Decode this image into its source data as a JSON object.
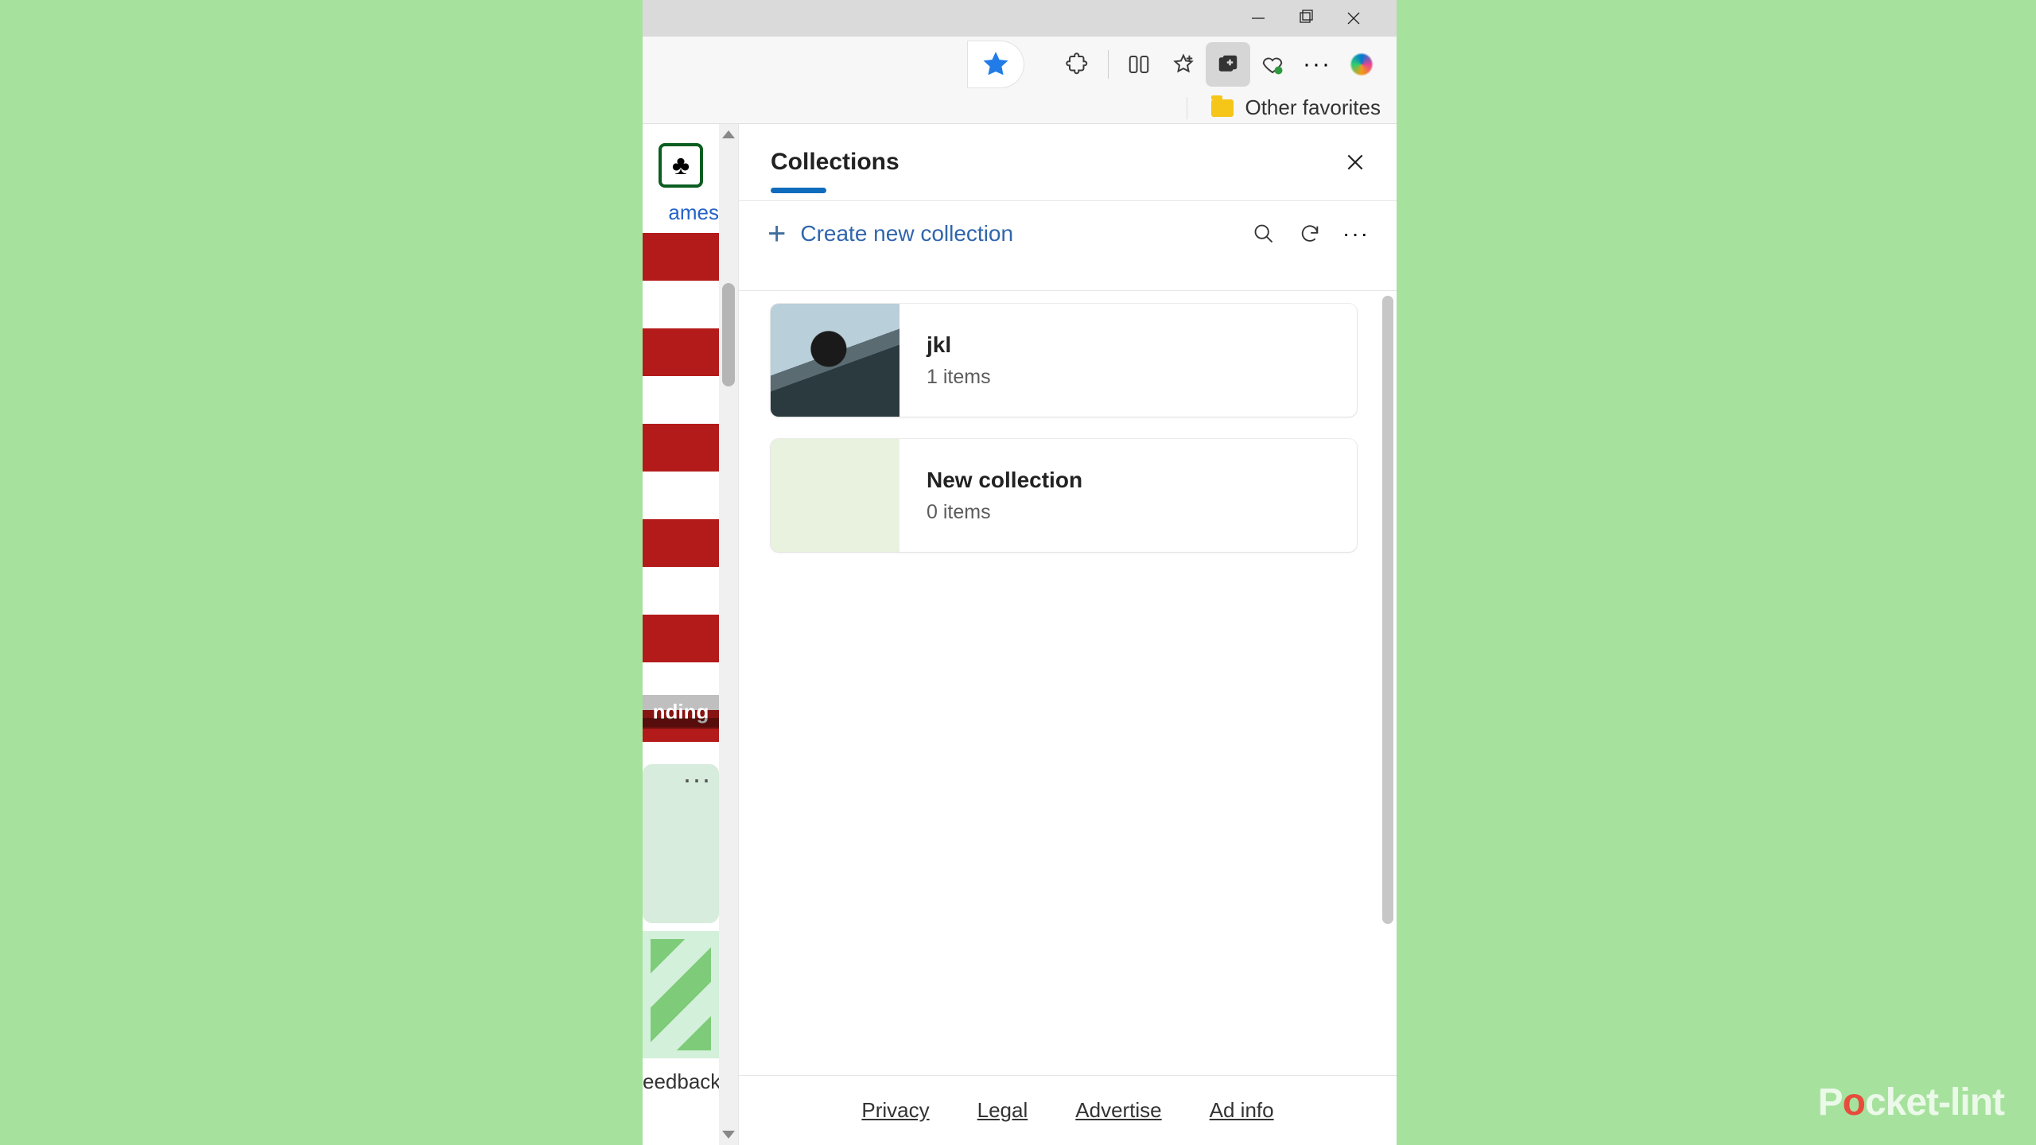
{
  "window_controls": {
    "minimize": "–",
    "maximize": "▢",
    "close": "✕"
  },
  "toolbar": {
    "star": "favorite",
    "extensions": "extensions",
    "split": "split-screen",
    "favorites": "favorites",
    "collections": "collections",
    "health": "browser-essentials",
    "more": "···",
    "copilot": "copilot"
  },
  "favorites_bar": {
    "other_favorites": "Other favorites"
  },
  "webstrip": {
    "games_link": "ames",
    "trending_label": "nding",
    "ellipsis": "···",
    "feedback": "eedback"
  },
  "collections": {
    "title": "Collections",
    "create_label": "Create new collection",
    "icons": {
      "search": "search",
      "refresh": "refresh",
      "more": "more"
    },
    "items": [
      {
        "name": "jkl",
        "sub": "1 items",
        "thumb": "jkl"
      },
      {
        "name": "New collection",
        "sub": "0 items",
        "thumb": "empty"
      }
    ],
    "footer": {
      "privacy": "Privacy",
      "legal": "Legal",
      "advertise": "Advertise",
      "adinfo": "Ad info"
    }
  },
  "watermark": {
    "pre": "P",
    "o": "o",
    "post": "cket-lint"
  }
}
